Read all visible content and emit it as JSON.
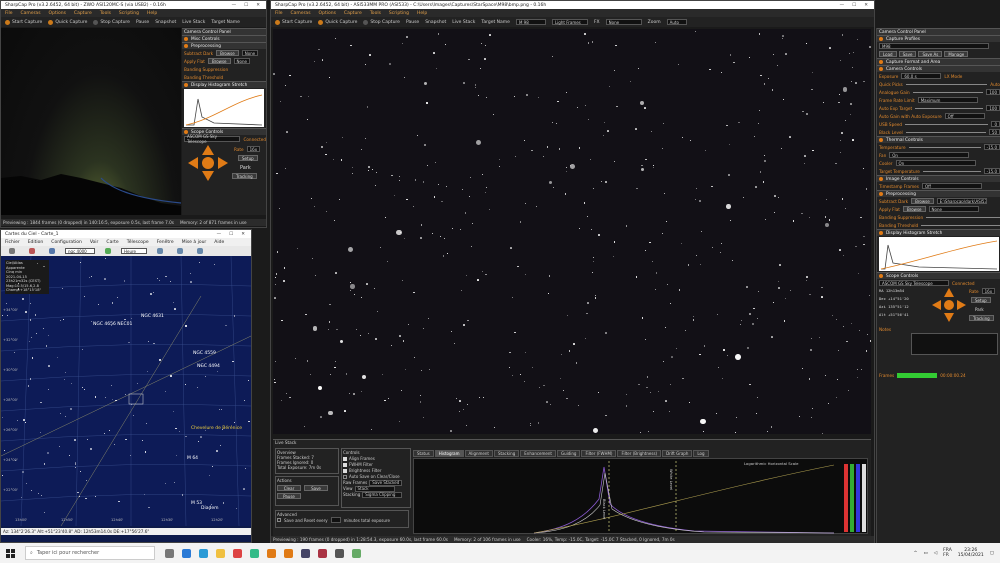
{
  "left_capture": {
    "title": "SharpCap Pro (v3.2.6452, 64 bit) - ZWO ASI120MC-S (via USB2) - 0.16h",
    "menu": [
      "File",
      "Cameras",
      "Options",
      "Capture",
      "Tools",
      "Scripting",
      "Help"
    ],
    "toolbar": {
      "start": "Start Capture",
      "quick": "Quick Capture",
      "stop": "Stop Capture",
      "pause": "Pause",
      "snapshot": "Snapshot",
      "live_stack": "Live Stack",
      "target": "Target Name"
    },
    "panel_title": "Camera Control Panel",
    "misc_controls": "Misc Controls",
    "preprocessing": "Preprocessing",
    "subtract_dark_label": "Subtract Dark",
    "subtract_dark_browse": "Browse",
    "subtract_dark_value": "None",
    "apply_flat_label": "Apply Flat",
    "apply_flat_browse": "Browse",
    "apply_flat_value": "None",
    "banding_suppression": "Banding Suppression",
    "banding_threshold": "Banding Threshold",
    "histogram": "Display Histogram Stretch",
    "scope": "Scope Controls",
    "scope_name": "ASCOM GS Sky Telescope",
    "connected": "Connected",
    "rate_label": "Rate",
    "rate_value": "16x",
    "setup": "Setup",
    "park": "Park",
    "tracking": "Tracking",
    "status": "Previewing : 1844 frames (0 dropped) in 140:16:5, exposure 0.5s, last frame 7.0s",
    "memory": "Memory: 2 of 871 frames in use"
  },
  "cdc": {
    "title": "Cartes du Ciel - Carte_1",
    "menu": [
      "Fichier",
      "Edition",
      "Configuration",
      "Voir",
      "Carte",
      "Télescope",
      "Fenêtre",
      "Mise à jour",
      "Aide"
    ],
    "search": "ngc 4000",
    "time": "Heure",
    "info": [
      "Ciel/Atlas",
      "Apparente",
      "Cinq min",
      "2021-04-15",
      "23h21m32s (CEST)",
      "Mag:10.5/15.6,2.8",
      "Champ:+18°15'18\""
    ],
    "labels": [
      "NGC 4631",
      "NGC 4656 NEC01",
      "NGC 4559",
      "NGC 4494",
      "Chevelure de Bérénice",
      "M 64",
      "M 53",
      "Diadem"
    ],
    "dec_ticks": [
      "+34°00'",
      "+32°00'",
      "+30°00'",
      "+28°00'",
      "+26°00'",
      "+24°00'",
      "+22°00'",
      "+20°00'",
      "+18°00'"
    ],
    "ra_ticks": [
      "13h00'",
      "12h50'",
      "12h40'",
      "12h30'",
      "12h20'"
    ],
    "bottom_status": "Az: 134°2'26.3\" Alt:+51°23'40.8\"  AD: 12h53m14.0s DE:+17°56'27.6\""
  },
  "main_capture": {
    "title": "SharpCap Pro (v3.2.6452, 64 bit) - ASI533MM PRO (ASI533) - C:\\Users\\Images\\Captures\\StarSpace\\M98\\bmp.png - 0.16h",
    "menu": [
      "File",
      "Cameras",
      "Options",
      "Capture",
      "Tools",
      "Scripting",
      "Help"
    ],
    "toolbar": {
      "start": "Start Capture",
      "quick": "Quick Capture",
      "stop": "Stop Capture",
      "pause": "Pause",
      "snapshot": "Snapshot",
      "live_stack": "Live Stack",
      "target_label": "Target Name",
      "target_value": "M 98",
      "frames": "Light Frames",
      "fx_label": "FX",
      "fx_value": "None",
      "zoom_label": "Zoom",
      "zoom_value": "Auto"
    },
    "live_stack": {
      "title": "Live Stack",
      "overview": "Overview",
      "frames_stacked": "Frames Stacked: 7",
      "frames_ignored": "Frames Ignored: 0",
      "total_exposure": "Total Exposure: 7m 0s",
      "actions": "Actions",
      "clear": "Clear",
      "save": "Save",
      "pause": "Pause",
      "controls": "Controls",
      "align": "Align Frames",
      "fwhm": "FWHM Filter",
      "brightness": "Brightness Filter",
      "autosave": "Auto Save on Clear/Close",
      "raw_frames_label": "Raw Frames",
      "raw_frames_value": "Save Stacked",
      "view_label": "View",
      "view_value": "Stack",
      "stacking_label": "Stacking",
      "stacking_value": "Sigma Clipping",
      "advanced": "Advanced",
      "save_reset": "Save and Reset every",
      "minutes": "minutes total exposure",
      "tabs": [
        "Status",
        "Histogram",
        "Alignment",
        "Stacking",
        "Enhancement",
        "Guiding",
        "Filter (FWHM)",
        "Filter (Brightness)",
        "Drift Graph",
        "Log"
      ],
      "log_stretch": "Logarithmic Horizontal Scale",
      "black_level": "Black Level",
      "white_level": "White Level"
    },
    "status": "Previewing : 190 frames (0 dropped) in 1:28:54.3, exposure 60.0s, last frame 60.0s",
    "memory": "Memory: 2 of 106 frames in use",
    "stack_status": "Cooler: 16%, Temp: -15.0C, Target: -15.0C  7 Stacked, 0 Ignored, 7m 0s"
  },
  "right_panel": {
    "title": "Camera Control Panel",
    "capture_profiles": "Capture Profiles",
    "profile": "M98",
    "load": "Load",
    "save": "Save",
    "save_as": "Save As",
    "manage": "Manage",
    "format_area": "Capture Format and Area",
    "camera_controls": "Camera Controls",
    "exposure_label": "Exposure",
    "exposure_value": "60.0 s",
    "lx_mode": "LX Mode",
    "quick_picks": "Quick Picks",
    "auto": "Auto",
    "gain_label": "Analogue Gain",
    "gain_value": "100",
    "frame_rate_label": "Frame Rate Limit",
    "frame_rate_value": "Maximum",
    "auto_exp_label": "Auto Exp Target",
    "auto_exp_value": "100",
    "auto_gain_label": "Auto Gain with Auto Exposure",
    "auto_gain_value": "Off",
    "usb_label": "USB Speed",
    "usb_value": "0",
    "black_label": "Black Level",
    "black_value": "50",
    "thermal": "Thermal Controls",
    "temp_label": "Temperature",
    "temp_value": "-15.0",
    "fan_label": "Fan",
    "fan_value": "On",
    "cooler_label": "Cooler",
    "cooler_value": "On",
    "target_temp_label": "Target Temperature",
    "target_temp_value": "-15.0",
    "image_controls": "Image Controls",
    "timestamp_label": "Timestamp Frames",
    "timestamp_value": "Off",
    "preprocessing": "Preprocessing",
    "dark_label": "Subtract Dark",
    "dark_browse": "Browse",
    "dark_value": "E:\\Sharpcap\\dark\\ASI533MM_PRO...",
    "flat_label": "Apply Flat",
    "flat_browse": "Browse",
    "flat_value": "None",
    "banding_sup": "Banding Suppression",
    "banding_thr": "Banding Threshold",
    "histogram": "Display Histogram Stretch",
    "scope": "Scope Controls",
    "scope_name": "ASCOM GS Sky Telescope",
    "connected": "Connected",
    "ra": "RA  12h13m54",
    "dec": "Dec +14°51'20",
    "az": "Azi  135°51'12",
    "alt": "Alt  +51°56'41",
    "rate_label": "Rate",
    "rate_value": "16x",
    "setup": "Setup",
    "park": "Park",
    "tracking": "Tracking",
    "notes": "Notes",
    "frames_label": "Frames",
    "timer": "00:00:00.24"
  },
  "taskbar": {
    "search": "Taper ici pour rechercher",
    "lang": "FRA",
    "lang2": "FR",
    "time": "23:26",
    "date": "15/04/2021"
  }
}
